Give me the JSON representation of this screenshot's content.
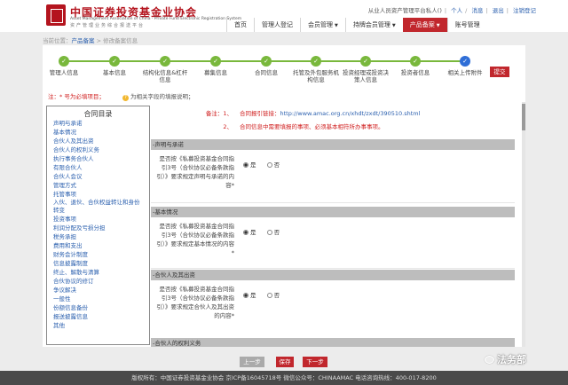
{
  "header": {
    "brand_cn": "中国证券投资基金业协会",
    "brand_en": "Asset Management Association of China · Private Fund Electronic Registration System",
    "brand_sub": "资产管理业务综合报送平台",
    "top_links": {
      "greeting": "从业人员资产管理平台私人()",
      "personal": "个人",
      "messages": "消息",
      "logout": "退出",
      "register": "注销登记"
    },
    "nav": [
      "首页",
      "管理人登记",
      "会员管理",
      "持牌会员管理",
      "产品备案",
      "账号管理"
    ],
    "nav_active_index": 4
  },
  "breadcrumb": {
    "prefix": "当前位置：",
    "level1": "产品备案",
    "level2": "修改备案信息"
  },
  "steps": [
    {
      "label": "管理人信息",
      "done": true
    },
    {
      "label": "基本信息",
      "done": true
    },
    {
      "label": "结构化信息&杠杆信息",
      "done": true
    },
    {
      "label": "募集信息",
      "done": true
    },
    {
      "label": "合同信息",
      "done": true
    },
    {
      "label": "托管及外包服务机构信息",
      "done": true
    },
    {
      "label": "投资经理或投资决策人信息",
      "done": true
    },
    {
      "label": "投资者信息",
      "done": true
    },
    {
      "label": "相关上传附件",
      "done": false,
      "current": true
    }
  ],
  "submit_label": "提交",
  "notice": {
    "required": "注：* 号为必填项目；",
    "tip": "为相关字段的填报说明；"
  },
  "toc": {
    "title": "合同目录",
    "items": [
      "声明与承诺",
      "基本情况",
      "合伙人及其出资",
      "合伙人的权利义务",
      "执行事务合伙人",
      "有限合伙人",
      "合伙人会议",
      "管理方式",
      "托管事项",
      "入伙、退伙、合伙权益转让和身份转变",
      "投资事项",
      "利润分配及亏损分担",
      "税务承担",
      "费用和支出",
      "财务会计制度",
      "信息披露制度",
      "终止、解散与清算",
      "合伙协议的修订",
      "争议解决",
      "一般性",
      "份额信息备份",
      "报送披露信息",
      "其他"
    ]
  },
  "remarks": {
    "label": "备注：",
    "items": [
      {
        "num": "1、",
        "text": "合同报引链接：",
        "url": "http://www.amac.org.cn/xhdt/zxdt/390510.shtml"
      },
      {
        "num": "2、",
        "text": "合同信息中需要填报的事项、必须基本相符所办事事项。"
      }
    ]
  },
  "sections": [
    {
      "title": "-声明与承诺",
      "question": "是否按《私募投资基金合同指引3号（合伙协议必备条款指引）》要求规定声明与承诺的内容*",
      "yes": "是",
      "no": "否",
      "selected": "yes"
    },
    {
      "title": "-基本情况",
      "question": "是否按《私募投资基金合同指引3号（合伙协议必备条款指引）》要求规定基本情况的内容*",
      "yes": "是",
      "no": "否",
      "selected": "yes"
    },
    {
      "title": "-合伙人及其出资",
      "question": "是否按《私募投资基金合同指引3号（合伙协议必备条款指引）》要求规定合伙人及其出资的内容*",
      "yes": "是",
      "no": "否",
      "selected": "yes"
    },
    {
      "title": "-合伙人的权利义务"
    }
  ],
  "buttons": {
    "prev": "上一步",
    "save": "保存",
    "next": "下一步"
  },
  "footer": "版权所有：中国证券投资基金业协会   京ICP备16045718号   微信公众号：CHINAAMAC   电话咨询热线：400-017-8200",
  "watermark": "法务部",
  "colors": {
    "brand_red": "#c1272d",
    "step_done": "#79b83c",
    "step_current": "#2f6ed7",
    "link_blue": "#2a5fae"
  }
}
